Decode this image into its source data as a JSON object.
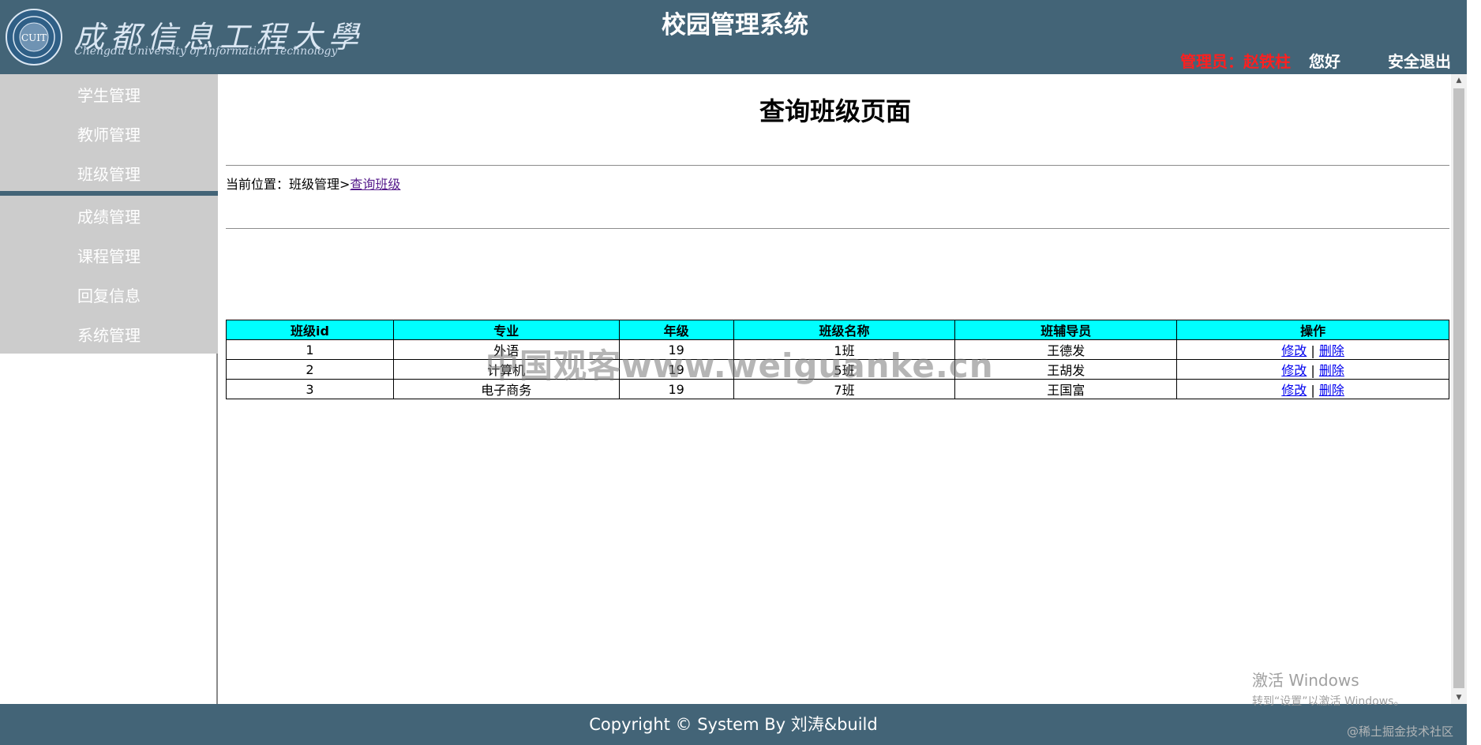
{
  "header": {
    "logo_cn": "成都信息工程大學",
    "logo_en": "Chengdu University of Information Technology",
    "emblem_text": "CUIT",
    "system_title": "校园管理系统",
    "admin_label": "管理员：赵铁柱",
    "greeting": "您好",
    "logout": "安全退出"
  },
  "sidebar": {
    "group1": [
      {
        "label": "学生管理"
      },
      {
        "label": "教师管理"
      },
      {
        "label": "班级管理"
      }
    ],
    "group2": [
      {
        "label": "成绩管理"
      },
      {
        "label": "课程管理"
      },
      {
        "label": "回复信息"
      },
      {
        "label": "系统管理"
      }
    ]
  },
  "main": {
    "page_title": "查询班级页面",
    "breadcrumb": {
      "prefix": "当前位置：班级管理>",
      "current": "查询班级"
    },
    "table": {
      "headers": [
        "班级id",
        "专业",
        "年级",
        "班级名称",
        "班辅导员",
        "操作"
      ],
      "rows": [
        {
          "id": "1",
          "major": "外语",
          "grade": "19",
          "name": "1班",
          "counselor": "王德发",
          "edit": "修改",
          "sep": "|",
          "delete": "删除"
        },
        {
          "id": "2",
          "major": "计算机",
          "grade": "19",
          "name": "5班",
          "counselor": "王胡发",
          "edit": "修改",
          "sep": "|",
          "delete": "删除"
        },
        {
          "id": "3",
          "major": "电子商务",
          "grade": "19",
          "name": "7班",
          "counselor": "王国富",
          "edit": "修改",
          "sep": "|",
          "delete": "删除"
        }
      ]
    }
  },
  "footer": {
    "copyright": "Copyright © System By 刘涛&build"
  },
  "overlays": {
    "watermark_center": "中国观客www.weiguanke.cn",
    "activate_line1": "激活 Windows",
    "activate_line2": "转到“设置”以激活 Windows。",
    "corner_watermark": "@稀土掘金技术社区"
  },
  "colors": {
    "header_bg": "#436477",
    "sidebar_bg": "#cccccc",
    "table_header_bg": "#00ffff",
    "admin_color": "#ff1f1f"
  }
}
